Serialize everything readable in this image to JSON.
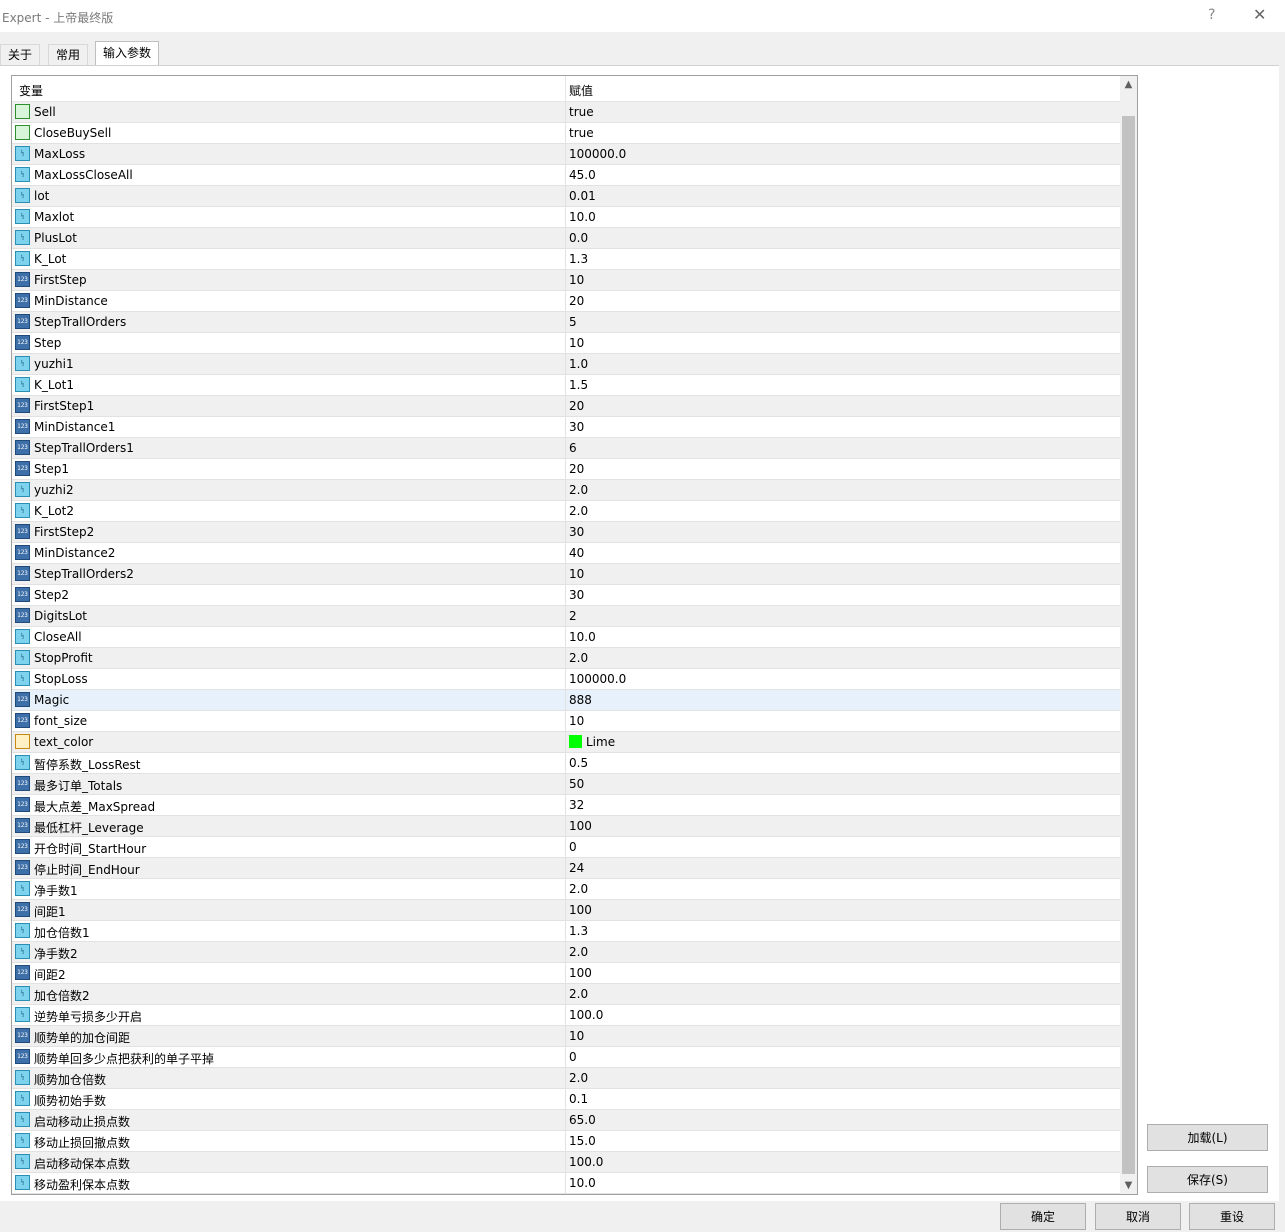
{
  "window": {
    "title": "Expert - 上帝最终版",
    "help": "?",
    "close": "✕"
  },
  "tabs": [
    {
      "label": "关于"
    },
    {
      "label": "常用"
    },
    {
      "label": "输入参数",
      "active": true
    }
  ],
  "grid": {
    "headers": {
      "variable": "变量",
      "value": "赋值"
    },
    "rows": [
      {
        "name": "Sell",
        "value": "true",
        "icon": "bool"
      },
      {
        "name": "CloseBuySell",
        "value": "true",
        "icon": "bool"
      },
      {
        "name": "MaxLoss",
        "value": "100000.0",
        "icon": "double"
      },
      {
        "name": "MaxLossCloseAll",
        "value": "45.0",
        "icon": "double"
      },
      {
        "name": "lot",
        "value": "0.01",
        "icon": "double"
      },
      {
        "name": "Maxlot",
        "value": "10.0",
        "icon": "double"
      },
      {
        "name": "PlusLot",
        "value": "0.0",
        "icon": "double"
      },
      {
        "name": "K_Lot",
        "value": "1.3",
        "icon": "double"
      },
      {
        "name": "FirstStep",
        "value": "10",
        "icon": "int"
      },
      {
        "name": "MinDistance",
        "value": "20",
        "icon": "int"
      },
      {
        "name": "StepTrallOrders",
        "value": "5",
        "icon": "int"
      },
      {
        "name": "Step",
        "value": "10",
        "icon": "int"
      },
      {
        "name": "yuzhi1",
        "value": "1.0",
        "icon": "double"
      },
      {
        "name": "K_Lot1",
        "value": "1.5",
        "icon": "double"
      },
      {
        "name": "FirstStep1",
        "value": "20",
        "icon": "int"
      },
      {
        "name": "MinDistance1",
        "value": "30",
        "icon": "int"
      },
      {
        "name": "StepTrallOrders1",
        "value": "6",
        "icon": "int"
      },
      {
        "name": "Step1",
        "value": "20",
        "icon": "int"
      },
      {
        "name": "yuzhi2",
        "value": "2.0",
        "icon": "double"
      },
      {
        "name": "K_Lot2",
        "value": "2.0",
        "icon": "double"
      },
      {
        "name": "FirstStep2",
        "value": "30",
        "icon": "int"
      },
      {
        "name": "MinDistance2",
        "value": "40",
        "icon": "int"
      },
      {
        "name": "StepTrallOrders2",
        "value": "10",
        "icon": "int"
      },
      {
        "name": "Step2",
        "value": "30",
        "icon": "int"
      },
      {
        "name": "DigitsLot",
        "value": "2",
        "icon": "int"
      },
      {
        "name": "CloseAll",
        "value": "10.0",
        "icon": "double"
      },
      {
        "name": "StopProfit",
        "value": "2.0",
        "icon": "double"
      },
      {
        "name": "StopLoss",
        "value": "100000.0",
        "icon": "double"
      },
      {
        "name": "Magic",
        "value": "888",
        "icon": "int",
        "selected": true
      },
      {
        "name": "font_size",
        "value": "10",
        "icon": "int"
      },
      {
        "name": "text_color",
        "value": "Lime",
        "icon": "color",
        "swatch": "#00ff00"
      },
      {
        "name": "暂停系数_LossRest",
        "value": "0.5",
        "icon": "double"
      },
      {
        "name": "最多订单_Totals",
        "value": "50",
        "icon": "int"
      },
      {
        "name": "最大点差_MaxSpread",
        "value": "32",
        "icon": "int"
      },
      {
        "name": "最低杠杆_Leverage",
        "value": "100",
        "icon": "int"
      },
      {
        "name": "开仓时间_StartHour",
        "value": "0",
        "icon": "int"
      },
      {
        "name": "停止时间_EndHour",
        "value": "24",
        "icon": "int"
      },
      {
        "name": "净手数1",
        "value": "2.0",
        "icon": "double"
      },
      {
        "name": "间距1",
        "value": "100",
        "icon": "int"
      },
      {
        "name": "加仓倍数1",
        "value": "1.3",
        "icon": "double"
      },
      {
        "name": "净手数2",
        "value": "2.0",
        "icon": "double"
      },
      {
        "name": "间距2",
        "value": "100",
        "icon": "int"
      },
      {
        "name": "加仓倍数2",
        "value": "2.0",
        "icon": "double"
      },
      {
        "name": "逆势单亏损多少开启",
        "value": "100.0",
        "icon": "double"
      },
      {
        "name": "顺势单的加仓间距",
        "value": "10",
        "icon": "int"
      },
      {
        "name": "顺势单回多少点把获利的单子平掉",
        "value": "0",
        "icon": "int"
      },
      {
        "name": "顺势加仓倍数",
        "value": "2.0",
        "icon": "double"
      },
      {
        "name": "顺势初始手数",
        "value": "0.1",
        "icon": "double"
      },
      {
        "name": "启动移动止损点数",
        "value": "65.0",
        "icon": "double"
      },
      {
        "name": "移动止损回撤点数",
        "value": "15.0",
        "icon": "double"
      },
      {
        "name": "启动移动保本点数",
        "value": "100.0",
        "icon": "double"
      },
      {
        "name": "移动盈利保本点数",
        "value": "10.0",
        "icon": "double"
      }
    ]
  },
  "buttons": {
    "load": "加载(L)",
    "save": "保存(S)",
    "ok": "确定",
    "cancel": "取消",
    "reset": "重设"
  },
  "colors": {
    "swatch_lime": "#00ff00",
    "selected_row": "#e7f1fb"
  },
  "icons": {
    "int": "123",
    "double": "½",
    "bool": "bool-icon",
    "color": "color-icon"
  }
}
